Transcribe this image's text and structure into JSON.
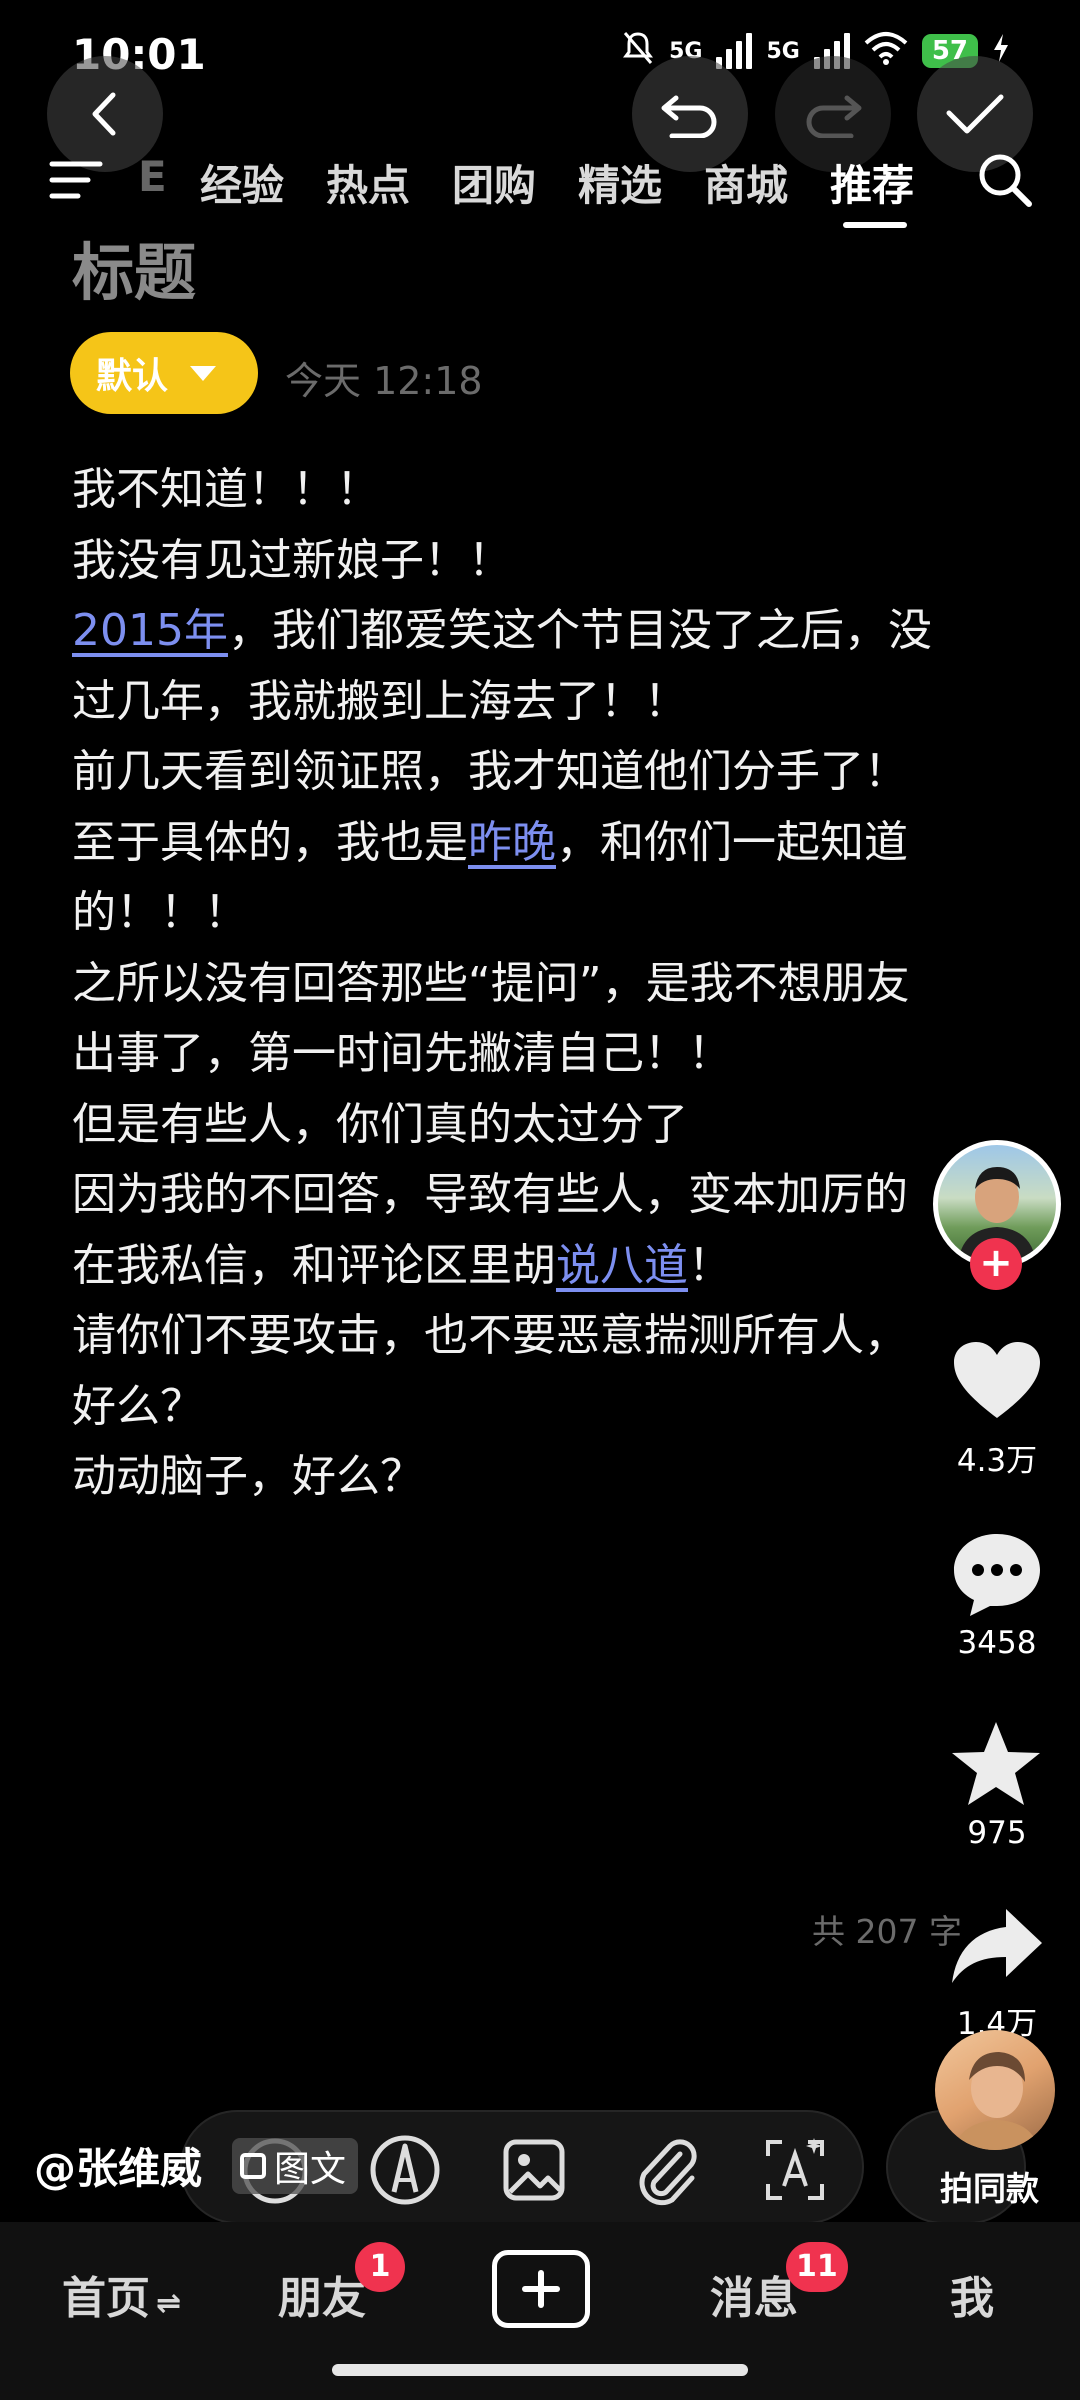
{
  "status_bar": {
    "time": "10:01",
    "network_1": "5G",
    "network_2": "5G",
    "battery": "57"
  },
  "tabs": [
    "E",
    "经验",
    "热点",
    "团购",
    "精选",
    "商城",
    "推荐"
  ],
  "active_tab": "推荐",
  "editor": {
    "title_placeholder": "标题",
    "category": "默认",
    "datetime": "今天 12:18",
    "word_count": "共 207 字"
  },
  "body_lines": [
    [
      {
        "t": "我不知道！！！"
      }
    ],
    [
      {
        "t": "我没有见过新娘子！！"
      }
    ],
    [
      {
        "t": "2015年",
        "link": true
      },
      {
        "t": "，我们都爱笑这个节目没了之后，没"
      }
    ],
    [
      {
        "t": "过几年，我就搬到上海去了！！"
      }
    ],
    [
      {
        "t": "前几天看到领证照，我才知道他们分手了！"
      }
    ],
    [
      {
        "t": "至于具体的，我也是"
      },
      {
        "t": "昨晚",
        "link": true
      },
      {
        "t": "，和你们一起知道"
      }
    ],
    [
      {
        "t": "的！！！"
      }
    ],
    [
      {
        "t": "之所以没有回答那些“提问”，是我不想朋友"
      }
    ],
    [
      {
        "t": "出事了，第一时间先撇清自己！！"
      }
    ],
    [
      {
        "t": "但是有些人，你们真的太过分了"
      }
    ],
    [
      {
        "t": "因为我的不回答，导致有些人，变本加厉的"
      }
    ],
    [
      {
        "t": "在我私信，和评论区里胡"
      },
      {
        "t": "说八道",
        "link": true
      },
      {
        "t": "！"
      }
    ],
    [
      {
        "t": "请你们不要攻击，也不要恶意揣测所有人，"
      }
    ],
    [
      {
        "t": "好么？"
      }
    ],
    [
      {
        "t": "动动脑子，好么？"
      }
    ]
  ],
  "actions": {
    "likes": "4.3万",
    "comments": "3458",
    "favorites": "975",
    "shares": "1.4万"
  },
  "author": "@张维威",
  "toolbar": {
    "tuwen_label": "图文",
    "shoot_same_label": "拍同款"
  },
  "nav": {
    "home": "首页",
    "friends": "朋友",
    "friends_badge": "1",
    "messages": "消息",
    "messages_badge": "11",
    "me": "我"
  },
  "colors": {
    "accent_yellow": "#f5c518",
    "link_blue": "#7d8ff0",
    "badge_red": "#f0334f",
    "battery_green": "#3fbf4a"
  }
}
